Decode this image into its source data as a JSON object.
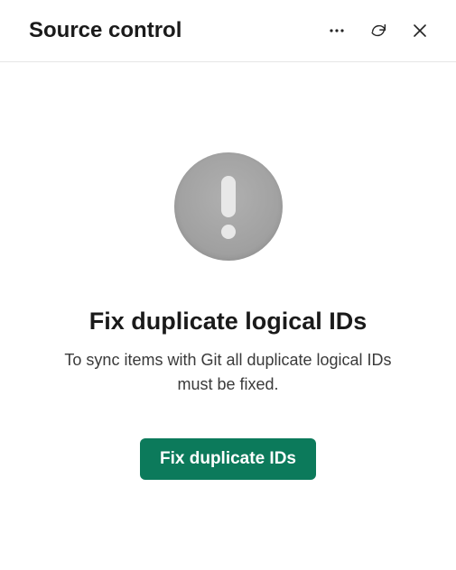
{
  "header": {
    "title": "Source control"
  },
  "message": {
    "title": "Fix duplicate logical IDs",
    "body": "To sync items with Git all duplicate logical IDs must be fixed."
  },
  "actions": {
    "primary_label": "Fix duplicate IDs"
  }
}
